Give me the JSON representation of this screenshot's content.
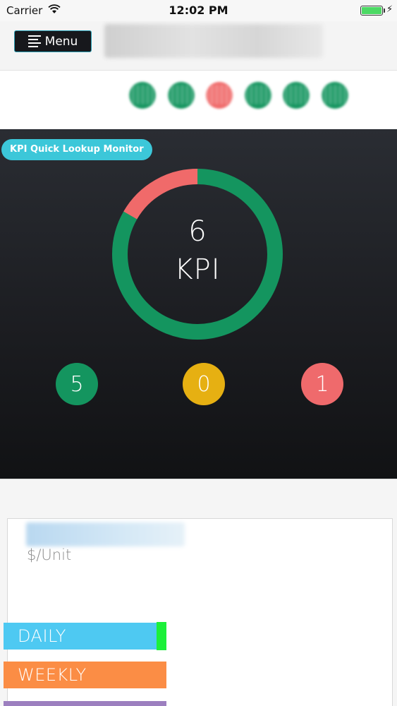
{
  "status_bar": {
    "carrier": "Carrier",
    "time": "12:02 PM",
    "battery_color": "#4cd964"
  },
  "header": {
    "menu_label": "Menu",
    "menu_icon": "list-icon"
  },
  "indicator_dots": [
    {
      "color": "#14955f"
    },
    {
      "color": "#14955f"
    },
    {
      "color": "#f06a6a"
    },
    {
      "color": "#14955f"
    },
    {
      "color": "#14955f"
    },
    {
      "color": "#14955f"
    }
  ],
  "kpi_monitor": {
    "badge": "KPI Quick Lookup Monitor",
    "total": "6",
    "label": "KPI",
    "ring": {
      "good_fraction": 0.8333,
      "bad_fraction": 0.1667,
      "good_color": "#14955f",
      "bad_color": "#f06a6a"
    },
    "counts": [
      {
        "name": "good",
        "value": "5",
        "color": "#14955f"
      },
      {
        "name": "warning",
        "value": "0",
        "color": "#e6b012"
      },
      {
        "name": "alert",
        "value": "1",
        "color": "#ef6a6c"
      }
    ]
  },
  "metric_card": {
    "unit": "$/Unit"
  },
  "period_tabs": [
    {
      "label": "DAILY",
      "color": "#4ec9f2",
      "active": true
    },
    {
      "label": "WEEKLY",
      "color": "#fb8d45",
      "active": false
    },
    {
      "label": "",
      "color": "#9c7fbf",
      "active": false
    }
  ]
}
